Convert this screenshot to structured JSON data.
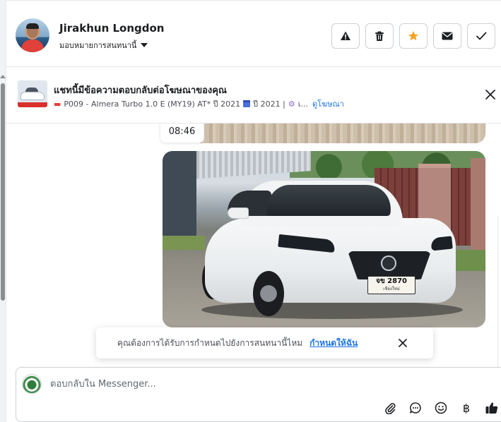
{
  "header": {
    "contact_name": "Jirakhun Longdon",
    "assign_label": "มอบหมายการสนทนานี้",
    "actions": [
      {
        "name": "report-spam-button",
        "icon": "warning-icon"
      },
      {
        "name": "delete-button",
        "icon": "trash-icon"
      },
      {
        "name": "star-button",
        "icon": "star-icon",
        "color": "#f5a623"
      },
      {
        "name": "mark-unread-button",
        "icon": "envelope-icon"
      },
      {
        "name": "mark-done-button",
        "icon": "checkmark-icon"
      }
    ]
  },
  "ad_banner": {
    "title": "แชทนี้มีข้อความตอบกลับต่อโฆษณาของคุณ",
    "subtitle_model": "P009 - Almera Turbo 1.0 E (MY19) AT* ปี 2021",
    "subtitle_year": "ปี 2021 |",
    "subtitle_ellipsis": "เ...",
    "view_ad_link": "ดูโฆษณา"
  },
  "conversation": {
    "timestamp": "08:46",
    "image_plate_main": "จข 2870",
    "image_plate_sub": "เชียงใหม่"
  },
  "toast": {
    "text": "คุณต้องการได้รับการกำหนดไปยังการสนทนานี้ไหม",
    "link": "กำหนดให้ฉัน"
  },
  "composer": {
    "placeholder": "ตอบกลับใน Messenger...",
    "value": "",
    "tools": [
      "attachment-icon",
      "saved-replies-icon",
      "emoji-icon",
      "payment-baht-icon",
      "thumbs-up-icon"
    ],
    "baht_symbol": "฿"
  },
  "colors": {
    "accent_link": "#1b74e4",
    "star": "#f5a623",
    "border": "#ccd0d5"
  }
}
